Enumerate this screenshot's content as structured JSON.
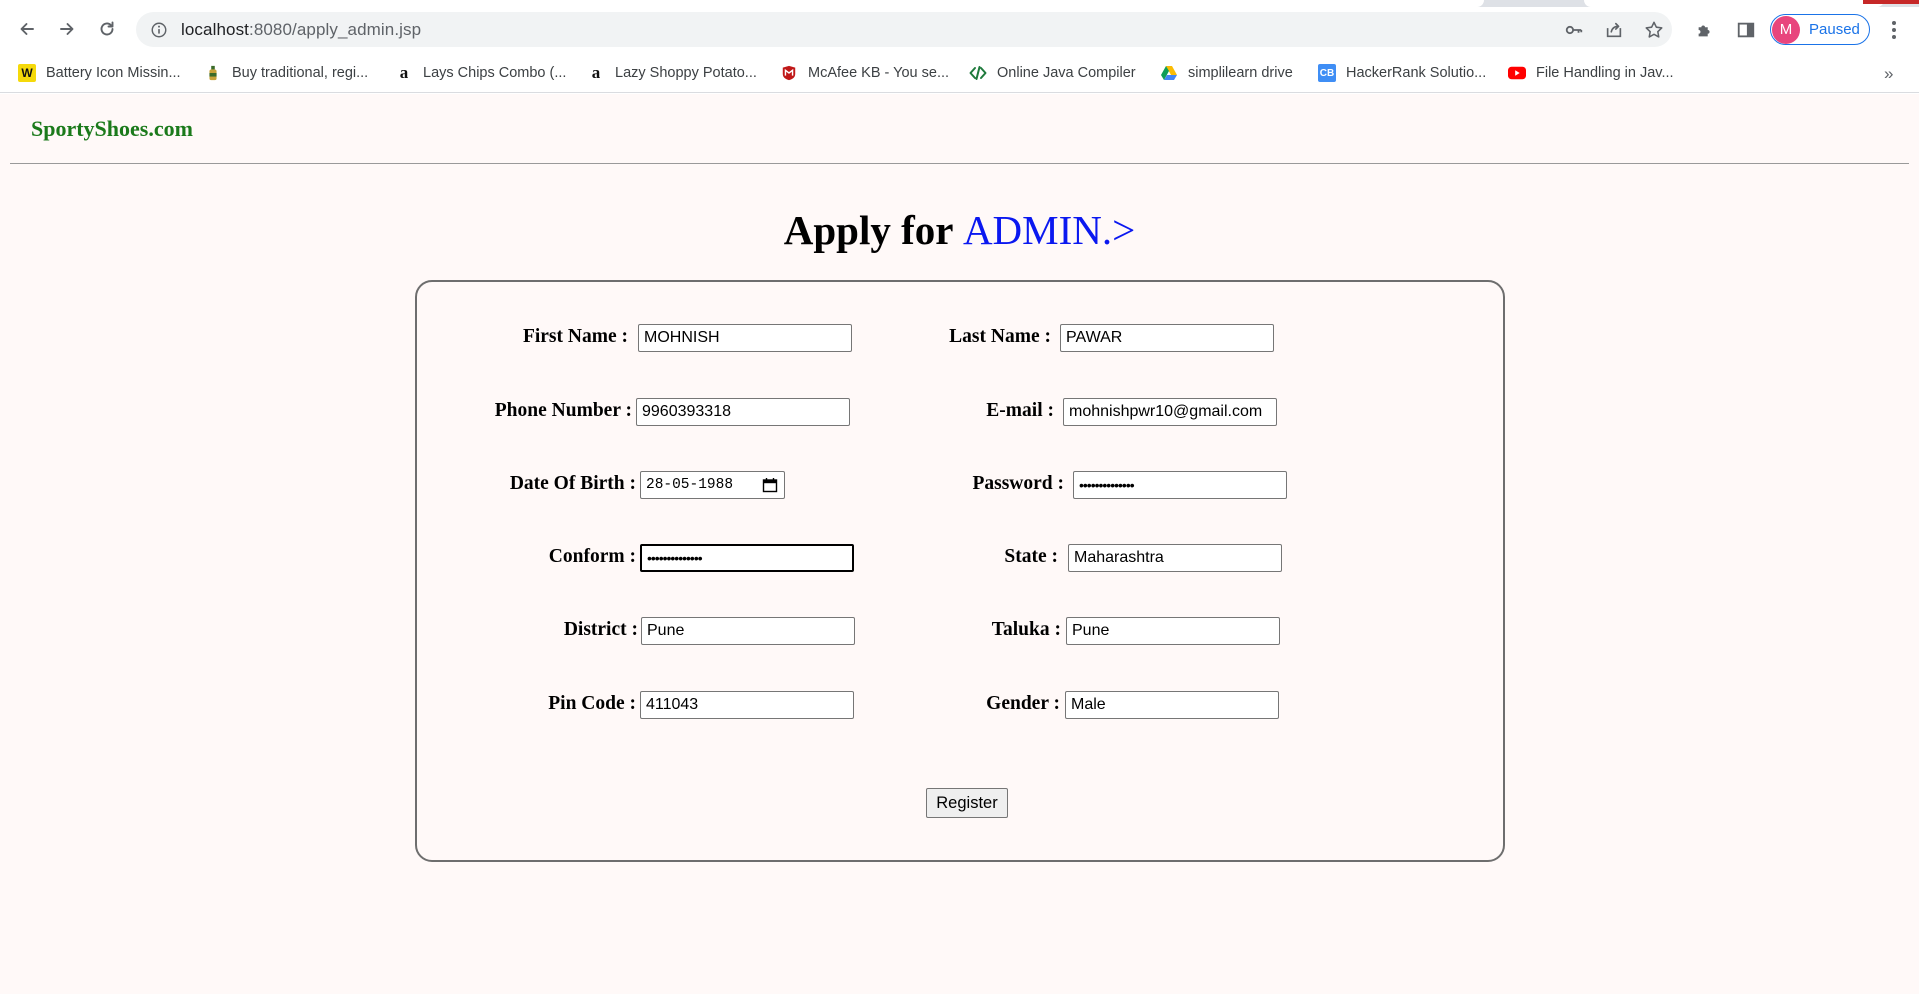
{
  "browser": {
    "url_host": "localhost",
    "url_path": ":8080/apply_admin.jsp",
    "profile_initial": "M",
    "profile_label": "Paused",
    "bookmarks": [
      {
        "label": "Battery Icon Missin...",
        "icon": "w-icon"
      },
      {
        "label": "Buy traditional, regi...",
        "icon": "bottle-icon"
      },
      {
        "label": "Lays Chips Combo (...",
        "icon": "amazon-icon"
      },
      {
        "label": "Lazy Shoppy Potato...",
        "icon": "amazon-icon"
      },
      {
        "label": "McAfee KB - You se...",
        "icon": "mcafee-icon"
      },
      {
        "label": "Online Java Compiler",
        "icon": "code-icon"
      },
      {
        "label": "simplilearn drive",
        "icon": "google-drive-icon"
      },
      {
        "label": "HackerRank Solutio...",
        "icon": "cb-icon"
      },
      {
        "label": "File Handling in Jav...",
        "icon": "youtube-icon"
      }
    ],
    "more_bookmarks": "»"
  },
  "page": {
    "brand": "SportyShoes.com",
    "heading_prefix": "Apply for ",
    "heading_accent": "ADMIN.>",
    "accent_color": "#0a18f0",
    "brand_color": "#1b7a1b",
    "form": {
      "first_name_label": "First Name :",
      "first_name_value": "MOHNISH",
      "last_name_label": "Last Name :",
      "last_name_value": "PAWAR",
      "phone_label": "Phone Number :",
      "phone_value": "9960393318",
      "email_label": "E-mail :",
      "email_value": "mohnishpwr10@gmail.com",
      "dob_label": "Date Of Birth :",
      "dob_value": "28-05-1988",
      "password_label": "Password :",
      "password_value": "••••••••••••••",
      "confirm_label": "Conform :",
      "confirm_value": "••••••••••••••",
      "state_label": "State :",
      "state_value": "Maharashtra",
      "district_label": "District :",
      "district_value": "Pune",
      "taluka_label": "Taluka :",
      "taluka_value": "Pune",
      "pincode_label": "Pin Code :",
      "pincode_value": "411043",
      "gender_label": "Gender :",
      "gender_value": "Male",
      "register_label": "Register"
    }
  }
}
